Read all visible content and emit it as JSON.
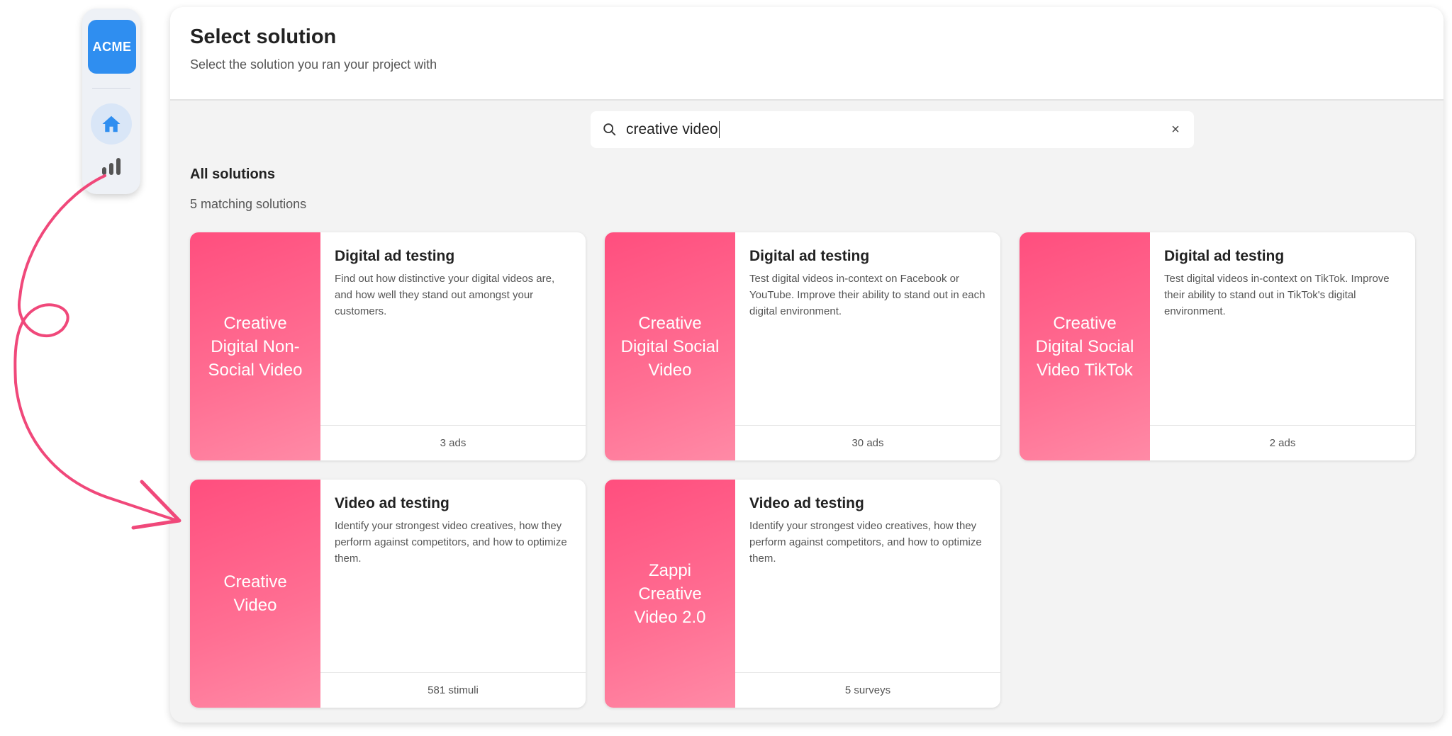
{
  "rail": {
    "logo_text": "ACME",
    "items": [
      {
        "icon": "home-icon"
      },
      {
        "icon": "bar-chart-icon"
      }
    ]
  },
  "header": {
    "title": "Select solution",
    "subtitle": "Select the solution you ran your project with"
  },
  "search": {
    "value": "creative video",
    "icon": "search-icon",
    "clear_icon": "close-icon"
  },
  "results": {
    "section_title": "All solutions",
    "count_text": "5 matching solutions",
    "cards": [
      {
        "thumb": "Creative Digital Non-Social Video",
        "title": "Digital ad testing",
        "description": "Find out how distinctive your digital videos are, and how well they stand out amongst your customers.",
        "footer": "3 ads"
      },
      {
        "thumb": "Creative Digital Social Video",
        "title": "Digital ad testing",
        "description": "Test digital videos in-context on Facebook or YouTube. Improve their ability to stand out in each digital environment.",
        "footer": "30 ads"
      },
      {
        "thumb": "Creative Digital Social Video TikTok",
        "title": "Digital ad testing",
        "description": "Test digital videos in-context on TikTok. Improve their ability to stand out in TikTok's digital environment.",
        "footer": "2 ads"
      },
      {
        "thumb": "Creative Video",
        "title": "Video ad testing",
        "description": "Identify your strongest video creatives, how they perform against competitors, and how to optimize them.",
        "footer": "581 stimuli"
      },
      {
        "thumb": "Zappi Creative Video 2.0",
        "title": "Video ad testing",
        "description": "Identify your strongest video creatives, how they perform against competitors, and how to optimize them.",
        "footer": "5 surveys"
      }
    ]
  },
  "colors": {
    "brand": "#2f8ef0",
    "thumb": "#ff5c86",
    "annotation": "#f0487a"
  }
}
